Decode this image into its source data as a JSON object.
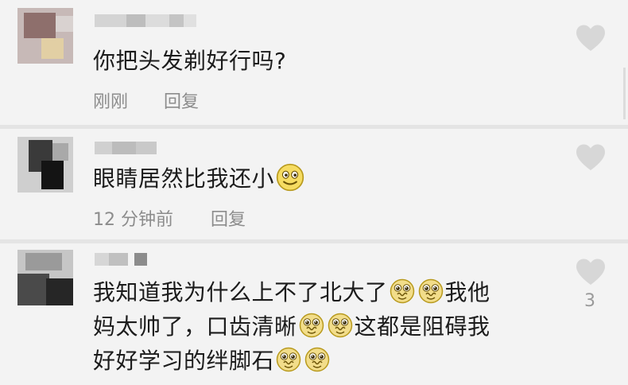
{
  "comments": [
    {
      "text": "你把头发剃好行吗?",
      "time": "刚刚",
      "reply_label": "回复",
      "icons": {
        "like": "heart-outline-icon"
      }
    },
    {
      "text": "眼睛居然比我还小",
      "time": "12 分钟前",
      "reply_label": "回复",
      "icons": {
        "like": "heart-outline-icon",
        "emoji": "smile-emoji"
      }
    },
    {
      "line1a": "我知道我为什么上不了北大了",
      "line1b": "我他",
      "line2a": "妈太帅了，口齿清晰",
      "line2b": "这都是阻碍我",
      "line3": "好好学习的绊脚石",
      "like_count": "3",
      "icons": {
        "like": "heart-outline-icon",
        "emoji": "pleading-emoji"
      }
    }
  ],
  "colors": {
    "background": "#f3f3f3",
    "text": "#1c1c1c",
    "meta": "#8c8c8c",
    "heart": "#d7d7d7"
  }
}
